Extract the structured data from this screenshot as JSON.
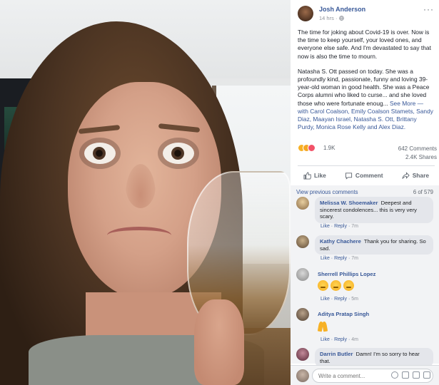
{
  "colors": {
    "link": "#385898",
    "text": "#1d2129",
    "muted": "#90949c",
    "bubble": "#e4e6eb",
    "panel": "#f2f3f5"
  },
  "post": {
    "author": "Josh Anderson",
    "time": "14 hrs",
    "privacy_icon": "globe-icon",
    "more_icon": "more-dots-icon",
    "more_label": "···",
    "paragraph1": "The time for joking about Covid-19 is over. Now is the time to keep yourself, your loved ones, and everyone else safe. And I'm devastated to say that now is also the time to mourn.",
    "paragraph2": "Natasha S. Ott passed on today. She was a profoundly kind, passionate, funny and loving 39-year-old woman in good health. She was a Peace Corps alumni who liked to curse... and she loved those who were fortunate enoug...",
    "see_more": "See More",
    "with_text": "— with",
    "tags": [
      "Carol Coalson",
      "Emily Coalson Stamets",
      "Sandy Diaz",
      "Maayan Israel",
      "Natasha S. Ott",
      "Brittany Purdy",
      "Monica Rose Kelly",
      "Alex Diaz"
    ],
    "tags_line": "Carol Coalson, Emily Coalson Stamets, Sandy Diaz, Maayan Israel, Natasha S. Ott, Brittany Purdy, Monica Rose Kelly and Alex Diaz."
  },
  "stats": {
    "reactions": "1.9K",
    "comments": "642 Comments",
    "shares": "2.4K Shares",
    "reaction_icons": [
      "haha-icon",
      "sad-icon",
      "love-icon"
    ]
  },
  "actions": {
    "like": "Like",
    "comment": "Comment",
    "share": "Share"
  },
  "comments_panel": {
    "view_previous": "View previous comments",
    "count": "6 of 579",
    "items": [
      {
        "name": "Melissa W. Shoemaker",
        "text": "Deepest and sincerest condolences... this is very very scary.",
        "like": "Like",
        "reply": "Reply",
        "time": "7m"
      },
      {
        "name": "Kathy Chachere",
        "text": "Thank you for sharing. So sad.",
        "like": "Like",
        "reply": "Reply",
        "time": "7m"
      },
      {
        "name": "Sherrell Phillips Lopez",
        "text": "",
        "emoji": [
          "sad-face-emoji",
          "sad-face-emoji",
          "sad-face-emoji"
        ],
        "like": "Like",
        "reply": "Reply",
        "time": "5m"
      },
      {
        "name": "Aditya Pratap Singh",
        "text": "",
        "emoji": [
          "folded-hands-emoji"
        ],
        "like": "Like",
        "reply": "Reply",
        "time": "4m"
      },
      {
        "name": "Darrin Butler",
        "text": "Damn! I'm so sorry to hear that.",
        "like": "",
        "reply": "",
        "time": ""
      }
    ],
    "separator": "·"
  },
  "write_comment": {
    "placeholder": "Write a comment..."
  }
}
